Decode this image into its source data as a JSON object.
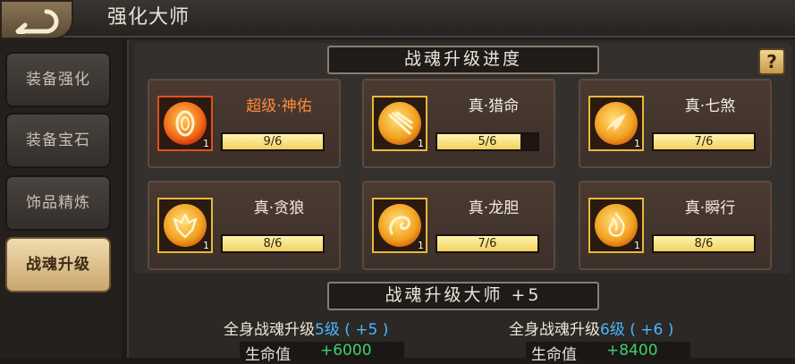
{
  "header": {
    "title": "强化大师"
  },
  "sidebar": {
    "items": [
      {
        "label": "装备强化"
      },
      {
        "label": "装备宝石"
      },
      {
        "label": "饰品精炼"
      },
      {
        "label": "战魂升级"
      }
    ],
    "active": "战魂升级"
  },
  "progress": {
    "header": "战魂升级进度",
    "help_label": "?",
    "cards": [
      {
        "name": "超级·神佑",
        "level": "1",
        "progress_text": "9/6",
        "progress_fraction": 1.0,
        "icon": "shield-rune-icon",
        "rarity_color": "#e0501e"
      },
      {
        "name": "真·猎命",
        "level": "1",
        "progress_text": "5/6",
        "progress_fraction": 0.83,
        "icon": "wolf-claw-icon",
        "rarity_color": "#e8b838"
      },
      {
        "name": "真·七煞",
        "level": "1",
        "progress_text": "7/6",
        "progress_fraction": 1.0,
        "icon": "phoenix-icon",
        "rarity_color": "#e8b838"
      },
      {
        "name": "真·贪狼",
        "level": "1",
        "progress_text": "8/6",
        "progress_fraction": 1.0,
        "icon": "wolf-head-icon",
        "rarity_color": "#e8b838"
      },
      {
        "name": "真·龙胆",
        "level": "1",
        "progress_text": "7/6",
        "progress_fraction": 1.0,
        "icon": "dragon-icon",
        "rarity_color": "#e8b838"
      },
      {
        "name": "真·瞬行",
        "level": "1",
        "progress_text": "8/6",
        "progress_fraction": 1.0,
        "icon": "flame-horse-icon",
        "rarity_color": "#e8b838"
      }
    ]
  },
  "master": {
    "header": "战魂升级大师 +5",
    "current": {
      "prefix": "全身战魂升级",
      "level": "5级",
      "bonus": " ( +5 )",
      "stat_label": "生命值",
      "stat_value": "+6000"
    },
    "next": {
      "prefix": "全身战魂升级",
      "level": "6级",
      "bonus": " ( +6 )",
      "stat_label": "生命值",
      "stat_value": "+8400"
    }
  },
  "colors": {
    "accent_gold": "#e8b838",
    "highlight_red": "#ff8a3a",
    "level_blue": "#4ab6ff",
    "stat_green": "#3ed06a"
  }
}
